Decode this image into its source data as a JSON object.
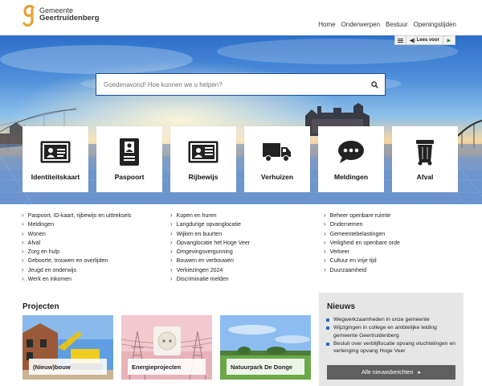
{
  "brand": {
    "line1": "Gemeente",
    "line2": "Geertruidenberg",
    "accent": "#e8a030"
  },
  "topnav": [
    "Home",
    "Onderwerpen",
    "Bestuur",
    "Openingstijden"
  ],
  "readspeaker": {
    "label": "Lees voor"
  },
  "search": {
    "placeholder": "Goedenavond! Hoe kunnen we u helpen?"
  },
  "tiles": [
    {
      "label": "Identiteitskaart",
      "icon": "id-card-icon"
    },
    {
      "label": "Paspoort",
      "icon": "passport-icon"
    },
    {
      "label": "Rijbewijs",
      "icon": "drivers-license-icon"
    },
    {
      "label": "Verhuizen",
      "icon": "truck-icon"
    },
    {
      "label": "Meldingen",
      "icon": "chat-bubble-icon"
    },
    {
      "label": "Afval",
      "icon": "trash-bin-icon"
    }
  ],
  "links": {
    "col1": [
      "Paspoort, ID-kaart, rijbewijs en uittreksels",
      "Meldingen",
      "Wonen",
      "Afval",
      "Zorg en hulp",
      "Geboorte, trouwen en overlijden",
      "Jeugd en onderwijs",
      "Werk en inkomen"
    ],
    "col2": [
      "Kopen en huren",
      "Langdurige opvanglocatie",
      "Wijken en buurten",
      "Opvanglocatie het Hoge Veer",
      "Omgevingsvergunning",
      "Bouwen en verbouwen",
      "Verkiezingen 2024",
      "Discriminatie melden"
    ],
    "col3": [
      "Beheer openbare ruimte",
      "Ondernemen",
      "Gemeentebelastingen",
      "Veiligheid en openbare orde",
      "Verkeer",
      "Cultuur en vrije tijd",
      "Duurzaamheid"
    ]
  },
  "projects": {
    "title": "Projecten",
    "items": [
      "(Nieuw)bouw",
      "Energieprojecten",
      "Natuurpark De Donge"
    ]
  },
  "news": {
    "title": "Nieuws",
    "items": [
      "Wegwerkzaamheden in onze gemeente",
      "Wijzigingen in college en ambtelijke leiding gemeente Geertruidenberg",
      "Besluit over verblijflocatie opvang vluchtelingen en verlenging opvang Hoge Veer"
    ],
    "button": "Alle nieuwsberichten"
  }
}
